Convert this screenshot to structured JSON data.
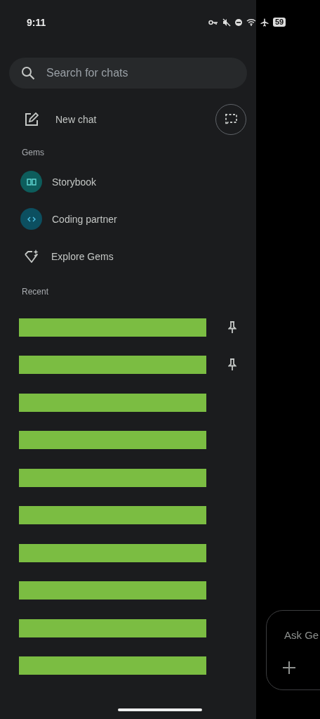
{
  "status_bar": {
    "time": "9:11",
    "battery": "59"
  },
  "search": {
    "placeholder": "Search for chats"
  },
  "new_chat": {
    "label": "New chat"
  },
  "gems": {
    "heading": "Gems",
    "items": [
      {
        "kind": "gem",
        "label": "Storybook",
        "color": "#0d5d5c"
      },
      {
        "kind": "gem",
        "label": "Coding partner",
        "color": "#0c4f60"
      },
      {
        "kind": "explore",
        "label": "Explore Gems"
      }
    ]
  },
  "recent": {
    "heading": "Recent",
    "items": [
      {
        "pinned": true
      },
      {
        "pinned": true
      },
      {
        "pinned": false
      },
      {
        "pinned": false
      },
      {
        "pinned": false
      },
      {
        "pinned": false
      },
      {
        "pinned": false
      },
      {
        "pinned": false
      },
      {
        "pinned": false
      },
      {
        "pinned": false
      }
    ]
  },
  "prompt": {
    "placeholder": "Ask Ge"
  }
}
